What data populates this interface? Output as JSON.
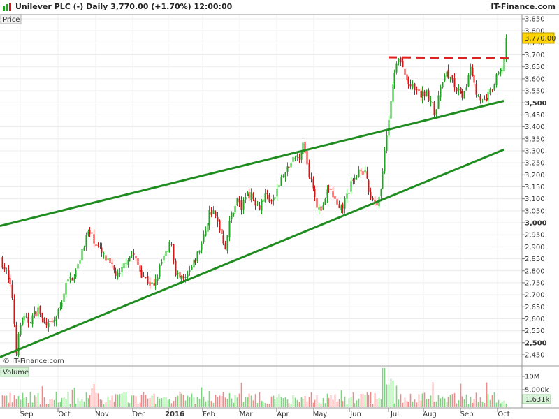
{
  "header": {
    "title": "Unilever PLC (-)   Daily   3,770.00 (+1.70%)   12:00:00",
    "brand": "IT-Finance.com"
  },
  "panel_labels": {
    "price": "Price",
    "volume": "Volume"
  },
  "watermark": "© IT-Finance.com",
  "colors": {
    "up": "#23a323",
    "down": "#d01818",
    "trend": "#1e8c1e",
    "resistance": "#e02020",
    "last_price_bg": "#ffd400"
  },
  "chart_data": {
    "type": "candlestick",
    "instrument": "Unilever PLC (-)",
    "interval": "Daily",
    "last_price": 3770.0,
    "last_price_label": "3,770.00",
    "change_pct": 1.7,
    "y_ticks": [
      "3,850",
      "3,800",
      "3,750",
      "3,700",
      "3,650",
      "3,600",
      "3,550",
      "3,500",
      "3,450",
      "3,400",
      "3,350",
      "3,300",
      "3,250",
      "3,200",
      "3,150",
      "3,100",
      "3,050",
      "3,000",
      "2,950",
      "2,900",
      "2,850",
      "2,800",
      "2,750",
      "2,700",
      "2,650",
      "2,600",
      "2,550",
      "2,500",
      "2,450"
    ],
    "y_ticks_bold": [
      "3,500",
      "3,000",
      "2,500"
    ],
    "ylim": [
      2420,
      3870
    ],
    "x_labels": [
      "Sep",
      "Oct",
      "Nov",
      "Dec",
      "2016",
      "Feb",
      "Mar",
      "Apr",
      "May",
      "Jun",
      "Jul",
      "Aug",
      "Sep",
      "Oct"
    ],
    "x_labels_bold": [
      "2016"
    ],
    "volume_ticks": [
      "10M",
      "5,000k"
    ],
    "volume_last_label": "1,631k",
    "lines": [
      {
        "name": "upper-trendline",
        "style": "solid",
        "from": [
          0,
          2987
        ],
        "to": [
          721,
          3508
        ]
      },
      {
        "name": "lower-trendline",
        "style": "solid",
        "from": [
          0,
          2440
        ],
        "to": [
          721,
          3305
        ]
      },
      {
        "name": "resistance",
        "style": "dashed",
        "from": [
          556,
          3690
        ],
        "to": [
          731,
          3685
        ]
      }
    ],
    "anchors": [
      [
        0,
        2850
      ],
      [
        8,
        2800
      ],
      [
        17,
        2700
      ],
      [
        23,
        2470
      ],
      [
        30,
        2600
      ],
      [
        40,
        2590
      ],
      [
        55,
        2640
      ],
      [
        65,
        2560
      ],
      [
        75,
        2580
      ],
      [
        85,
        2640
      ],
      [
        95,
        2750
      ],
      [
        110,
        2800
      ],
      [
        117,
        2890
      ],
      [
        125,
        2960
      ],
      [
        132,
        2940
      ],
      [
        140,
        2900
      ],
      [
        150,
        2850
      ],
      [
        160,
        2810
      ],
      [
        170,
        2770
      ],
      [
        180,
        2850
      ],
      [
        190,
        2870
      ],
      [
        200,
        2800
      ],
      [
        210,
        2760
      ],
      [
        220,
        2730
      ],
      [
        230,
        2830
      ],
      [
        235,
        2860
      ],
      [
        240,
        2880
      ],
      [
        245,
        2930
      ],
      [
        250,
        2800
      ],
      [
        258,
        2760
      ],
      [
        265,
        2760
      ],
      [
        272,
        2800
      ],
      [
        280,
        2850
      ],
      [
        290,
        2930
      ],
      [
        300,
        3050
      ],
      [
        305,
        3040
      ],
      [
        315,
        2970
      ],
      [
        322,
        2900
      ],
      [
        330,
        3030
      ],
      [
        340,
        3100
      ],
      [
        345,
        3060
      ],
      [
        353,
        3130
      ],
      [
        360,
        3110
      ],
      [
        370,
        3070
      ],
      [
        380,
        3120
      ],
      [
        390,
        3080
      ],
      [
        400,
        3170
      ],
      [
        410,
        3220
      ],
      [
        420,
        3260
      ],
      [
        428,
        3290
      ],
      [
        435,
        3330
      ],
      [
        440,
        3220
      ],
      [
        447,
        3170
      ],
      [
        455,
        3050
      ],
      [
        462,
        3060
      ],
      [
        470,
        3150
      ],
      [
        478,
        3100
      ],
      [
        485,
        3040
      ],
      [
        492,
        3080
      ],
      [
        500,
        3150
      ],
      [
        508,
        3180
      ],
      [
        515,
        3240
      ],
      [
        522,
        3200
      ],
      [
        528,
        3120
      ],
      [
        535,
        3090
      ],
      [
        540,
        3080
      ],
      [
        546,
        3180
      ],
      [
        550,
        3280
      ],
      [
        555,
        3420
      ],
      [
        560,
        3550
      ],
      [
        565,
        3640
      ],
      [
        570,
        3680
      ],
      [
        575,
        3650
      ],
      [
        580,
        3600
      ],
      [
        590,
        3560
      ],
      [
        600,
        3530
      ],
      [
        610,
        3540
      ],
      [
        618,
        3510
      ],
      [
        623,
        3440
      ],
      [
        628,
        3530
      ],
      [
        635,
        3630
      ],
      [
        645,
        3600
      ],
      [
        655,
        3540
      ],
      [
        665,
        3530
      ],
      [
        672,
        3670
      ],
      [
        680,
        3560
      ],
      [
        688,
        3490
      ],
      [
        696,
        3520
      ],
      [
        705,
        3560
      ],
      [
        712,
        3620
      ],
      [
        718,
        3640
      ],
      [
        722,
        3700
      ],
      [
        726,
        3770
      ]
    ]
  }
}
